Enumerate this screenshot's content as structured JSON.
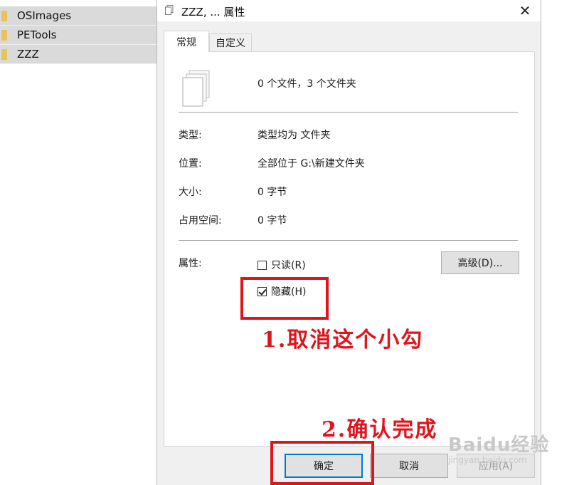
{
  "explorer": {
    "folders": [
      {
        "name": "OSImages"
      },
      {
        "name": "PETools"
      },
      {
        "name": "ZZZ"
      }
    ]
  },
  "dialog": {
    "title": "ZZZ, ... 属性",
    "close_glyph": "✕",
    "tabs": [
      {
        "label": "常规",
        "selected": true
      },
      {
        "label": "自定义",
        "selected": false
      }
    ],
    "summary": "0 个文件，3 个文件夹",
    "properties": {
      "type_label": "类型:",
      "type_value": "类型均为 文件夹",
      "location_label": "位置:",
      "location_value": "全部位于 G:\\新建文件夹",
      "size_label": "大小:",
      "size_value": "0 字节",
      "disk_label": "占用空间:",
      "disk_value": "0 字节",
      "attributes_label": "属性:"
    },
    "attributes": {
      "readonly_label": "只读(R)",
      "readonly_checked": false,
      "hidden_label": "隐藏(H)",
      "hidden_checked": true,
      "advanced_label": "高级(D)..."
    },
    "buttons": {
      "ok_label": "确定",
      "cancel_label": "取消",
      "apply_label": "应用(A)"
    }
  },
  "annotations": {
    "step1": "1.取消这个小勾",
    "step2": "2.确认完成",
    "color": "#e0141c"
  },
  "watermark": {
    "main": "Baidu经验",
    "sub": "jingyan.baidu.com"
  }
}
